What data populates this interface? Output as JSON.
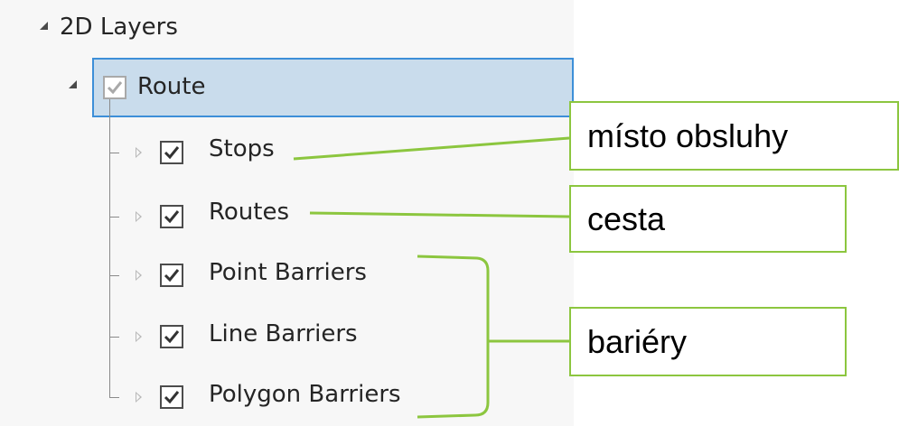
{
  "tree": {
    "root_label": "2D Layers",
    "group_label": "Route",
    "items": [
      {
        "label": "Stops",
        "checked": true
      },
      {
        "label": "Routes",
        "checked": true
      },
      {
        "label": "Point Barriers",
        "checked": true
      },
      {
        "label": "Line Barriers",
        "checked": true
      },
      {
        "label": "Polygon Barriers",
        "checked": true
      }
    ]
  },
  "callouts": {
    "stops": "místo obsluhy",
    "routes": "cesta",
    "barriers": "bariéry"
  },
  "colors": {
    "selection_bg": "#c9dcec",
    "selection_border": "#3d8fd8",
    "callout_border": "#8cc63f",
    "panel_bg": "#f7f7f7"
  },
  "icons": {
    "expanded": "expanded-triangle-icon",
    "collapsed": "collapsed-triangle-icon",
    "check": "checkmark-icon"
  }
}
